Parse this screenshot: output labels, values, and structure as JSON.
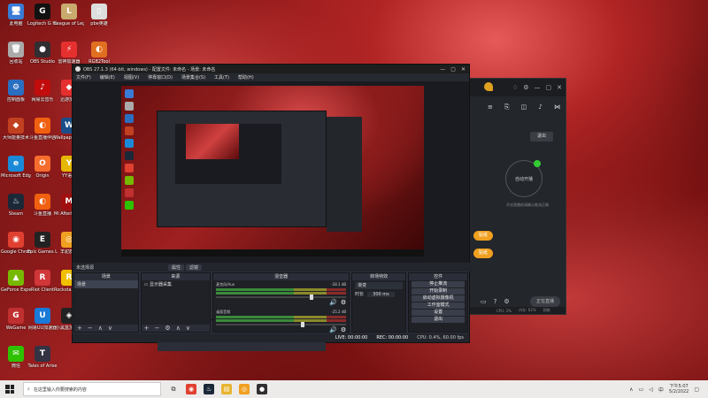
{
  "desktop": {
    "col1": [
      {
        "label": "此电脑",
        "color": "#3a7bd5",
        "glyph": "🖥"
      },
      {
        "label": "回收站",
        "color": "#aaa",
        "glyph": "🗑"
      },
      {
        "label": "控制面板",
        "color": "#2a6ec0",
        "glyph": "⚙"
      },
      {
        "label": "大师能量技术",
        "color": "#c04020",
        "glyph": "◆"
      },
      {
        "label": "Microsoft Edge",
        "color": "#1a8ad8",
        "glyph": "e"
      },
      {
        "label": "Steam",
        "color": "#1b2838",
        "glyph": "♨"
      },
      {
        "label": "Google Chrome",
        "color": "#e04030",
        "glyph": "◉"
      },
      {
        "label": "GeForce Experience",
        "color": "#76b900",
        "glyph": "▲"
      },
      {
        "label": "WeGame",
        "color": "#c03030",
        "glyph": "G"
      },
      {
        "label": "微信",
        "color": "#2dc100",
        "glyph": "✉"
      }
    ],
    "col2": [
      {
        "label": "Logitech G HUB",
        "color": "#111",
        "glyph": "G"
      },
      {
        "label": "OBS Studio",
        "color": "#302e31",
        "glyph": "●"
      },
      {
        "label": "网易云音乐",
        "color": "#c20c0c",
        "glyph": "♪"
      },
      {
        "label": "斗鱼直播伴侣",
        "color": "#f06010",
        "glyph": "◐"
      },
      {
        "label": "Origin",
        "color": "#f56c2d",
        "glyph": "O"
      },
      {
        "label": "斗鱼直播",
        "color": "#f06010",
        "glyph": "◐"
      },
      {
        "label": "Epic Games Launcher",
        "color": "#222",
        "glyph": "E"
      },
      {
        "label": "Riot Client",
        "color": "#d13639",
        "glyph": "R"
      },
      {
        "label": "网易UU加速器",
        "color": "#1a7ad8",
        "glyph": "U"
      },
      {
        "label": "Tales of Arise",
        "color": "#334",
        "glyph": "T"
      }
    ],
    "col3": [
      {
        "label": "League of Legends",
        "color": "#c8aa6e",
        "glyph": "L"
      },
      {
        "label": "雷神加速器",
        "color": "#e63030",
        "glyph": "⚡"
      },
      {
        "label": "迅游加速",
        "color": "#e63030",
        "glyph": "◆"
      },
      {
        "label": "Wallpaper Engine",
        "color": "#1a4e8a",
        "glyph": "W"
      },
      {
        "label": "YY语音",
        "color": "#e6b800",
        "glyph": "Y"
      },
      {
        "label": "Mi Afterburner",
        "color": "#a01010",
        "glyph": "M"
      },
      {
        "label": "羊驼群英",
        "color": "#f0a020",
        "glyph": "◎"
      },
      {
        "label": "Rockstar Games",
        "color": "#f0c000",
        "glyph": "R"
      },
      {
        "label": "小黑盒加速器",
        "color": "#222",
        "glyph": "◈"
      },
      {
        "label": "",
        "color": "transparent",
        "glyph": ""
      }
    ],
    "col4": [
      {
        "label": "pbe英雄",
        "color": "#ddd",
        "glyph": "▯"
      },
      {
        "label": "RGB2Tool",
        "color": "#e07020",
        "glyph": "◐"
      }
    ]
  },
  "obs": {
    "title": "OBS 27.1.3 (64-bit, windows) - 配置文件: 未命名 - 场景: 未命名",
    "menu": [
      "文件(F)",
      "编辑(E)",
      "视图(V)",
      "停靠窗口(D)",
      "场景集合(S)",
      "工具(T)",
      "帮助(H)"
    ],
    "scene_label": "未选择源",
    "tabs": [
      "属性",
      "滤镜"
    ],
    "docks": {
      "scenes": {
        "header": "场景",
        "items": [
          "场景"
        ]
      },
      "sources": {
        "header": "来源",
        "items": [
          "显示器采集"
        ]
      },
      "mixer": {
        "header": "混音器",
        "channels": [
          {
            "name": "麦克风/Aux",
            "db": "-28.1 dB",
            "level": 0.72
          },
          {
            "name": "桌面音频",
            "db": "-25.2 dB",
            "level": 0.65
          }
        ]
      },
      "transitions": {
        "header": "转场特效",
        "type": "渐变",
        "duration_label": "时长",
        "duration": "300 ms"
      },
      "controls": {
        "header": "控件",
        "buttons": [
          "停止推流",
          "开始录制",
          "启动虚拟摄像机",
          "工作室模式",
          "设置",
          "退出"
        ]
      }
    },
    "status": {
      "live": "LIVE: 00:00:00",
      "rec": "REC: 00:00:00",
      "cpu": "CPU: 0.4%, 60.00 fps"
    }
  },
  "companion": {
    "exit_label": "退出",
    "circle_label": "自动开播",
    "tip": "开启直播前请确认推流正确",
    "pills": [
      "贴纸",
      "贴纸"
    ],
    "live_button": "正在直播",
    "status": [
      "CPU: 2%",
      "内存: 62%",
      "网络"
    ]
  },
  "taskbar": {
    "search_placeholder": "在这里输入你要搜索的内容",
    "time": "下午5:07",
    "date": "5/2/2022"
  }
}
